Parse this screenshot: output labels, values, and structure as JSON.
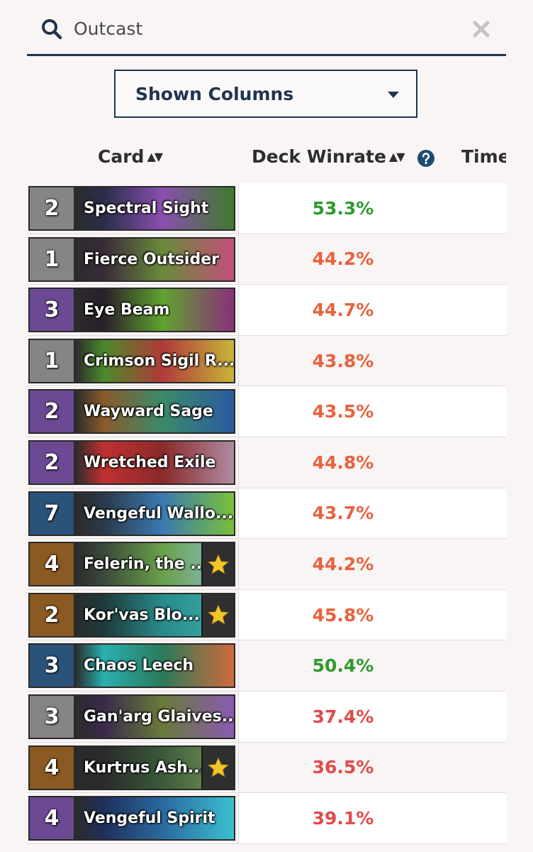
{
  "search": {
    "value": "Outcast",
    "icon": "search-icon",
    "clear_icon": "close-icon"
  },
  "columns_dropdown": {
    "label": "Shown Columns",
    "icon": "caret-down-icon"
  },
  "headers": {
    "card": "Card",
    "deck_winrate": "Deck Winrate",
    "time": "Time",
    "sort_symbol": "▲▼"
  },
  "colors": {
    "positive": "#2f9a2f",
    "negative_mild": "#e8623e",
    "negative": "#e04b4b",
    "cost_common": "#858585",
    "cost_rare": "#2b5278",
    "cost_epic": "#6b4a93",
    "cost_legendary": "#8a5a22",
    "accent": "#1f3550",
    "star": "#f2c62b"
  },
  "rows": [
    {
      "cost": "2",
      "name": "Spectral Sight",
      "winrate": "53.3%",
      "rarity": "common",
      "legendary": false,
      "trend": "positive",
      "art": [
        "#8a4fb0",
        "#3f7a2c",
        "#2a2e4a"
      ]
    },
    {
      "cost": "1",
      "name": "Fierce Outsider",
      "winrate": "44.2%",
      "rarity": "common",
      "legendary": false,
      "trend": "negative_mild",
      "art": [
        "#6a8a3a",
        "#c24f7a",
        "#3a2a3a"
      ]
    },
    {
      "cost": "3",
      "name": "Eye Beam",
      "winrate": "44.7%",
      "rarity": "epic",
      "legendary": false,
      "trend": "negative_mild",
      "art": [
        "#5fa32e",
        "#8a2f7a",
        "#2a1f2a"
      ]
    },
    {
      "cost": "1",
      "name": "Crimson Sigil R...",
      "winrate": "43.8%",
      "rarity": "common",
      "legendary": false,
      "trend": "negative_mild",
      "art": [
        "#b03a3a",
        "#c9b53a",
        "#4a8a2a"
      ]
    },
    {
      "cost": "2",
      "name": "Wayward Sage",
      "winrate": "43.5%",
      "rarity": "epic",
      "legendary": false,
      "trend": "negative_mild",
      "art": [
        "#3a8a6a",
        "#2a5aa0",
        "#8a5a2a"
      ]
    },
    {
      "cost": "2",
      "name": "Wretched Exile",
      "winrate": "44.8%",
      "rarity": "epic",
      "legendary": false,
      "trend": "negative_mild",
      "art": [
        "#8a2a2a",
        "#b08aa0",
        "#c03030"
      ]
    },
    {
      "cost": "7",
      "name": "Vengeful Wallo...",
      "winrate": "43.7%",
      "rarity": "rare",
      "legendary": false,
      "trend": "negative_mild",
      "art": [
        "#3a7ab0",
        "#7ac03a",
        "#2a3a4a"
      ]
    },
    {
      "cost": "4",
      "name": "Felerin, the ...",
      "winrate": "44.2%",
      "rarity": "legendary",
      "legendary": true,
      "trend": "negative_mild",
      "art": [
        "#6aa04a",
        "#8ac0d0",
        "#3a4a3a"
      ]
    },
    {
      "cost": "2",
      "name": "Kor'vas Blo...",
      "winrate": "45.8%",
      "rarity": "legendary",
      "legendary": true,
      "trend": "negative_mild",
      "art": [
        "#2a8a8a",
        "#3ab0b0",
        "#1f3a3a"
      ]
    },
    {
      "cost": "3",
      "name": "Chaos Leech",
      "winrate": "50.4%",
      "rarity": "rare",
      "legendary": false,
      "trend": "positive",
      "art": [
        "#2a7a5a",
        "#d06a3a",
        "#2ab0b0"
      ]
    },
    {
      "cost": "3",
      "name": "Gan'arg Glaives...",
      "winrate": "37.4%",
      "rarity": "common",
      "legendary": false,
      "trend": "negative",
      "art": [
        "#6a7a3a",
        "#8a5ab0",
        "#3a2a4a"
      ]
    },
    {
      "cost": "4",
      "name": "Kurtrus Ash...",
      "winrate": "36.5%",
      "rarity": "legendary",
      "legendary": true,
      "trend": "negative",
      "art": [
        "#3a5a3a",
        "#7a9a5a",
        "#2a2a2a"
      ]
    },
    {
      "cost": "4",
      "name": "Vengeful Spirit",
      "winrate": "39.1%",
      "rarity": "epic",
      "legendary": false,
      "trend": "negative",
      "art": [
        "#2a6aa0",
        "#3ac0d0",
        "#1f2f5a"
      ]
    }
  ]
}
